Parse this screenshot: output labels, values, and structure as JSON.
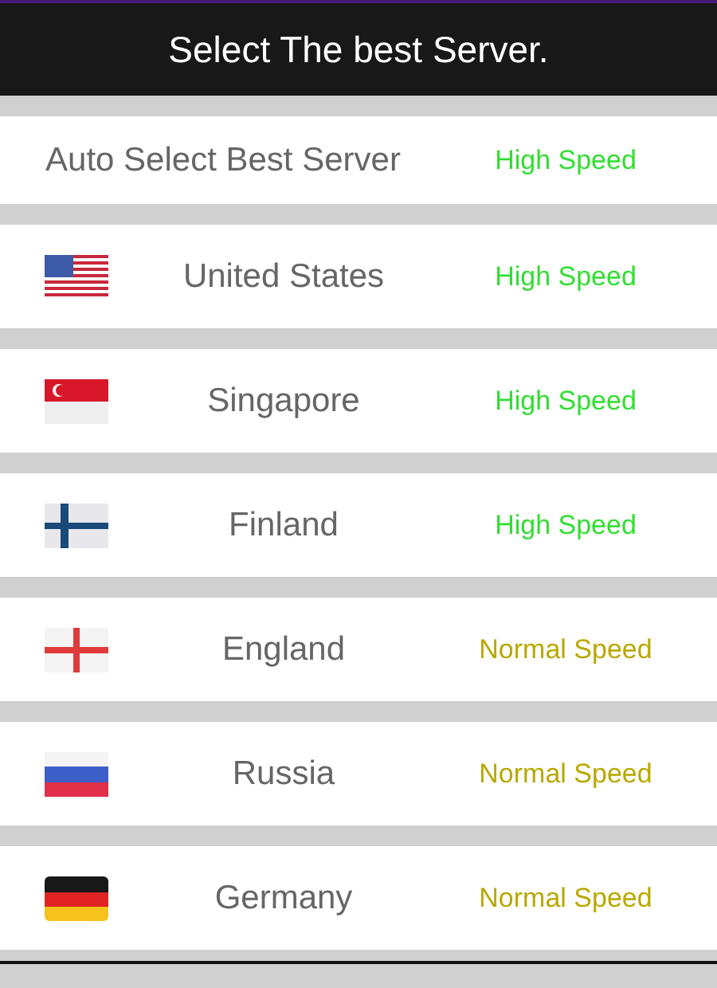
{
  "header": {
    "title": "Select The best Server."
  },
  "servers": [
    {
      "kind": "auto",
      "name": "Auto Select Best Server",
      "speed": "High Speed",
      "color": "#33dd33"
    },
    {
      "kind": "us",
      "name": "United States",
      "speed": "High Speed",
      "color": "#33dd33"
    },
    {
      "kind": "sg",
      "name": "Singapore",
      "speed": "High Speed",
      "color": "#33dd33"
    },
    {
      "kind": "fi",
      "name": "Finland",
      "speed": "High Speed",
      "color": "#33dd33"
    },
    {
      "kind": "en",
      "name": "England",
      "speed": "Normal Speed",
      "color": "#b8a800"
    },
    {
      "kind": "ru",
      "name": "Russia",
      "speed": "Normal Speed",
      "color": "#b8a800"
    },
    {
      "kind": "de",
      "name": "Germany",
      "speed": "Normal Speed",
      "color": "#b8a800"
    }
  ]
}
